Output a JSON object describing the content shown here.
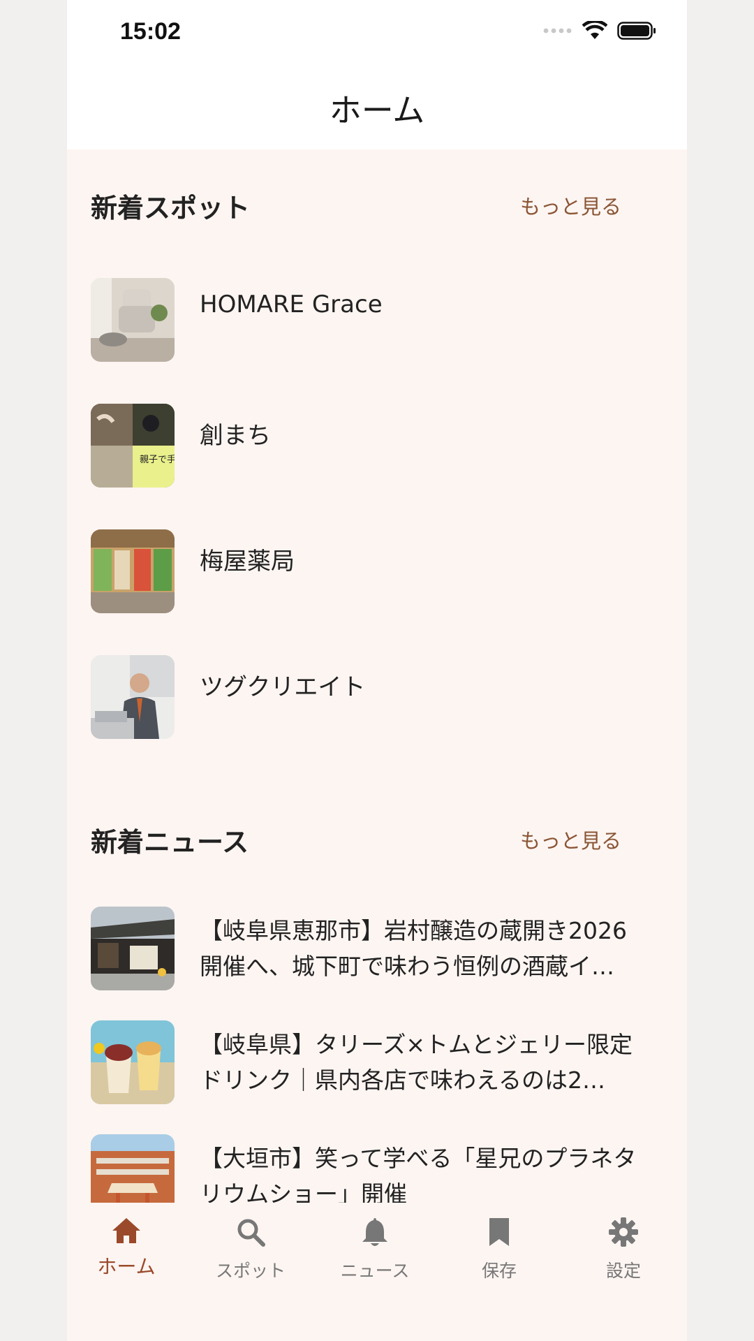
{
  "status": {
    "time": "15:02"
  },
  "header": {
    "title": "ホーム"
  },
  "spots": {
    "title": "新着スポット",
    "more": "もっと見る",
    "items": [
      {
        "name": "HOMARE Grace"
      },
      {
        "name": "創まち"
      },
      {
        "name": "梅屋薬局"
      },
      {
        "name": "ツグクリエイト"
      }
    ]
  },
  "news": {
    "title": "新着ニュース",
    "more": "もっと見る",
    "items": [
      {
        "text": "【岐阜県恵那市】岩村醸造の蔵開き2026開催へ、城下町で味わう恒例の酒蔵イ…"
      },
      {
        "text": "【岐阜県】タリーズ×トムとジェリー限定ドリンク｜県内各店で味わえるのは2…"
      },
      {
        "text": "【大垣市】笑って学べる「星兄のプラネタリウムショー」開催"
      }
    ]
  },
  "tabs": [
    {
      "label": "ホーム",
      "icon": "home-icon",
      "active": true
    },
    {
      "label": "スポット",
      "icon": "search-icon"
    },
    {
      "label": "ニュース",
      "icon": "bell-icon"
    },
    {
      "label": "保存",
      "icon": "bookmark-icon"
    },
    {
      "label": "設定",
      "icon": "gear-icon"
    }
  ],
  "colors": {
    "accent": "#9a4a2a",
    "link": "#8a5535",
    "background": "#fdf5f2"
  }
}
